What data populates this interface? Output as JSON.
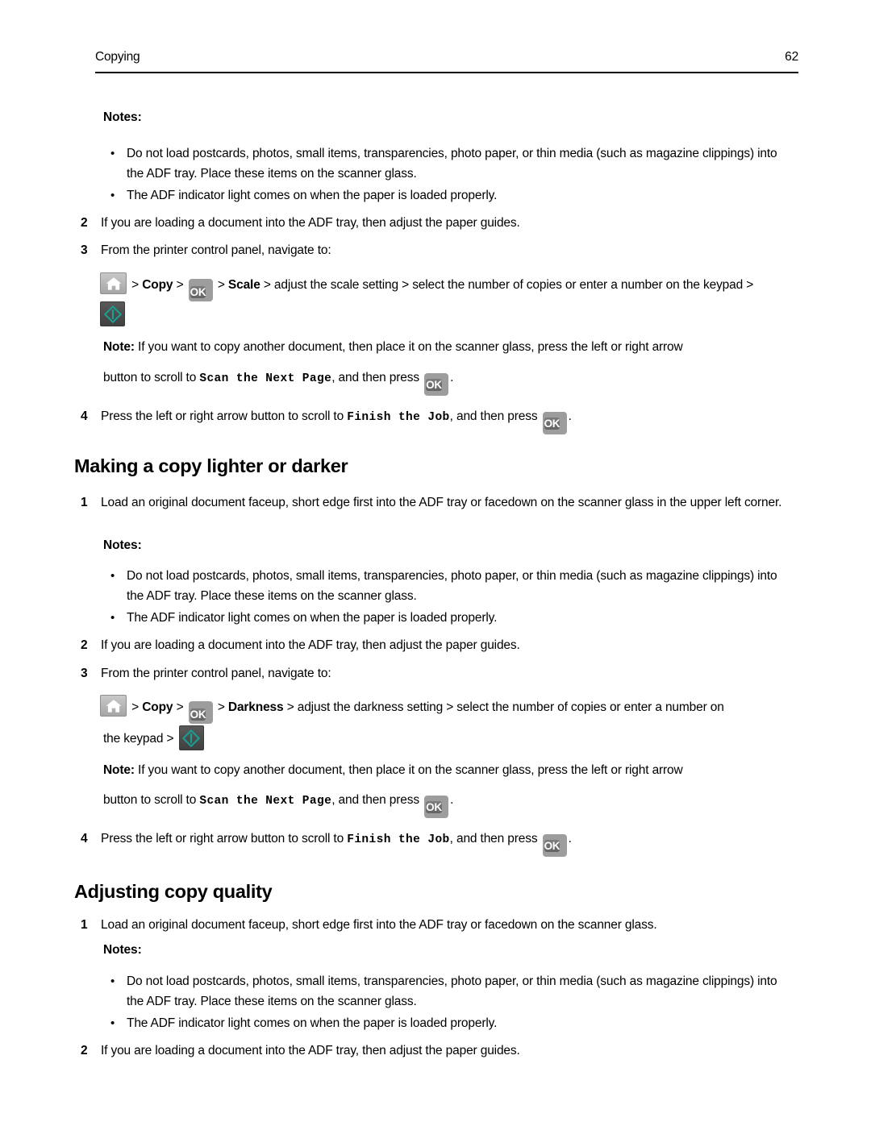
{
  "header": {
    "title": "Copying",
    "page_number": "62"
  },
  "icons": {
    "home": "home-icon",
    "ok": "OK",
    "start": "start-icon"
  },
  "section_1": {
    "notes_label": "Notes:",
    "notes": [
      "Do not load postcards, photos, small items, transparencies, photo paper, or thin media (such as magazine clippings) into the ADF tray. Place these items on the scanner glass.",
      "The ADF indicator light comes on when the paper is loaded properly."
    ],
    "step2_num": "2",
    "step2": "If you are loading a document into the ADF tray, then adjust the paper guides.",
    "step3_num": "3",
    "step3": "From the printer control panel, navigate to:",
    "nav": {
      "sep1": ">",
      "copy": "Copy",
      "sep2": ">",
      "sep3": ">",
      "setting": "Scale",
      "tail": "> adjust the scale setting > select the number of copies or enter a number on the keypad >"
    },
    "note_label": "Note:",
    "note_line1": "If you want to copy another document, then place it on the scanner glass, press the left or right arrow",
    "note_line2_pre": "button to scroll to",
    "note_line2_mono": "Scan the Next Page",
    "note_line2_post": ", and then press",
    "note_line2_end": ".",
    "step4_num": "4",
    "step4_pre": "Press the left or right arrow button to scroll to",
    "step4_mono": "Finish the Job",
    "step4_post": ", and then press",
    "step4_end": "."
  },
  "section_2": {
    "heading": "Making a copy lighter or darker",
    "step1_num": "1",
    "step1": "Load an original document faceup, short edge first into the ADF tray or facedown on the scanner glass in the upper left corner.",
    "notes_label": "Notes:",
    "notes": [
      "Do not load postcards, photos, small items, transparencies, photo paper, or thin media (such as magazine clippings) into the ADF tray. Place these items on the scanner glass.",
      "The ADF indicator light comes on when the paper is loaded properly."
    ],
    "step2_num": "2",
    "step2": "If you are loading a document into the ADF tray, then adjust the paper guides.",
    "step3_num": "3",
    "step3": "From the printer control panel, navigate to:",
    "nav": {
      "sep1": ">",
      "copy": "Copy",
      "sep2": ">",
      "sep3": ">",
      "setting": "Darkness",
      "tail": "> adjust the darkness setting > select the number of copies or enter a number on",
      "line2_pre": "the keypad >"
    },
    "note_label": "Note:",
    "note_line1": "If you want to copy another document, then place it on the scanner glass, press the left or right arrow",
    "note_line2_pre": "button to scroll to",
    "note_line2_mono": "Scan the Next Page",
    "note_line2_post": ", and then press",
    "note_line2_end": ".",
    "step4_num": "4",
    "step4_pre": "Press the left or right arrow button to scroll to",
    "step4_mono": "Finish the Job",
    "step4_post": ", and then press",
    "step4_end": "."
  },
  "section_3": {
    "heading": "Adjusting copy quality",
    "step1_num": "1",
    "step1": "Load an original document faceup, short edge first into the ADF tray or facedown on the scanner glass.",
    "notes_label": "Notes:",
    "notes": [
      "Do not load postcards, photos, small items, transparencies, photo paper, or thin media (such as magazine clippings) into the ADF tray. Place these items on the scanner glass.",
      "The ADF indicator light comes on when the paper is loaded properly."
    ],
    "step2_num": "2",
    "step2": "If you are loading a document into the ADF tray, then adjust the paper guides."
  }
}
